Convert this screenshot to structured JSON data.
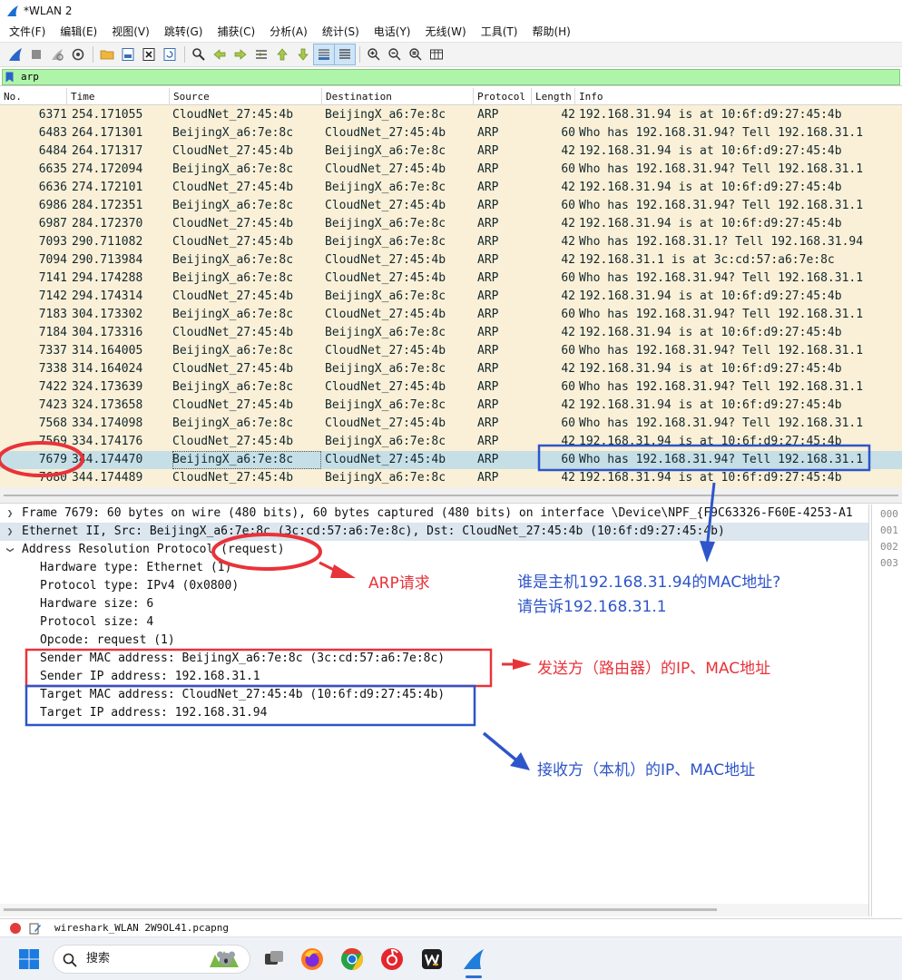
{
  "window": {
    "title": "*WLAN 2"
  },
  "menu": [
    "文件(F)",
    "编辑(E)",
    "视图(V)",
    "跳转(G)",
    "捕获(C)",
    "分析(A)",
    "统计(S)",
    "电话(Y)",
    "无线(W)",
    "工具(T)",
    "帮助(H)"
  ],
  "filter": {
    "value": "arp"
  },
  "columns": {
    "no": "No.",
    "time": "Time",
    "source": "Source",
    "destination": "Destination",
    "protocol": "Protocol",
    "length": "Length",
    "info": "Info"
  },
  "packets": [
    {
      "no": "6371",
      "time": "254.171055",
      "src": "CloudNet_27:45:4b",
      "dst": "BeijingX_a6:7e:8c",
      "proto": "ARP",
      "len": "42",
      "info": "192.168.31.94 is at 10:6f:d9:27:45:4b"
    },
    {
      "no": "6483",
      "time": "264.171301",
      "src": "BeijingX_a6:7e:8c",
      "dst": "CloudNet_27:45:4b",
      "proto": "ARP",
      "len": "60",
      "info": "Who has 192.168.31.94? Tell 192.168.31.1"
    },
    {
      "no": "6484",
      "time": "264.171317",
      "src": "CloudNet_27:45:4b",
      "dst": "BeijingX_a6:7e:8c",
      "proto": "ARP",
      "len": "42",
      "info": "192.168.31.94 is at 10:6f:d9:27:45:4b"
    },
    {
      "no": "6635",
      "time": "274.172094",
      "src": "BeijingX_a6:7e:8c",
      "dst": "CloudNet_27:45:4b",
      "proto": "ARP",
      "len": "60",
      "info": "Who has 192.168.31.94? Tell 192.168.31.1"
    },
    {
      "no": "6636",
      "time": "274.172101",
      "src": "CloudNet_27:45:4b",
      "dst": "BeijingX_a6:7e:8c",
      "proto": "ARP",
      "len": "42",
      "info": "192.168.31.94 is at 10:6f:d9:27:45:4b"
    },
    {
      "no": "6986",
      "time": "284.172351",
      "src": "BeijingX_a6:7e:8c",
      "dst": "CloudNet_27:45:4b",
      "proto": "ARP",
      "len": "60",
      "info": "Who has 192.168.31.94? Tell 192.168.31.1"
    },
    {
      "no": "6987",
      "time": "284.172370",
      "src": "CloudNet_27:45:4b",
      "dst": "BeijingX_a6:7e:8c",
      "proto": "ARP",
      "len": "42",
      "info": "192.168.31.94 is at 10:6f:d9:27:45:4b"
    },
    {
      "no": "7093",
      "time": "290.711082",
      "src": "CloudNet_27:45:4b",
      "dst": "BeijingX_a6:7e:8c",
      "proto": "ARP",
      "len": "42",
      "info": "Who has 192.168.31.1? Tell 192.168.31.94"
    },
    {
      "no": "7094",
      "time": "290.713984",
      "src": "BeijingX_a6:7e:8c",
      "dst": "CloudNet_27:45:4b",
      "proto": "ARP",
      "len": "42",
      "info": "192.168.31.1 is at 3c:cd:57:a6:7e:8c"
    },
    {
      "no": "7141",
      "time": "294.174288",
      "src": "BeijingX_a6:7e:8c",
      "dst": "CloudNet_27:45:4b",
      "proto": "ARP",
      "len": "60",
      "info": "Who has 192.168.31.94? Tell 192.168.31.1"
    },
    {
      "no": "7142",
      "time": "294.174314",
      "src": "CloudNet_27:45:4b",
      "dst": "BeijingX_a6:7e:8c",
      "proto": "ARP",
      "len": "42",
      "info": "192.168.31.94 is at 10:6f:d9:27:45:4b"
    },
    {
      "no": "7183",
      "time": "304.173302",
      "src": "BeijingX_a6:7e:8c",
      "dst": "CloudNet_27:45:4b",
      "proto": "ARP",
      "len": "60",
      "info": "Who has 192.168.31.94? Tell 192.168.31.1"
    },
    {
      "no": "7184",
      "time": "304.173316",
      "src": "CloudNet_27:45:4b",
      "dst": "BeijingX_a6:7e:8c",
      "proto": "ARP",
      "len": "42",
      "info": "192.168.31.94 is at 10:6f:d9:27:45:4b"
    },
    {
      "no": "7337",
      "time": "314.164005",
      "src": "BeijingX_a6:7e:8c",
      "dst": "CloudNet_27:45:4b",
      "proto": "ARP",
      "len": "60",
      "info": "Who has 192.168.31.94? Tell 192.168.31.1"
    },
    {
      "no": "7338",
      "time": "314.164024",
      "src": "CloudNet_27:45:4b",
      "dst": "BeijingX_a6:7e:8c",
      "proto": "ARP",
      "len": "42",
      "info": "192.168.31.94 is at 10:6f:d9:27:45:4b"
    },
    {
      "no": "7422",
      "time": "324.173639",
      "src": "BeijingX_a6:7e:8c",
      "dst": "CloudNet_27:45:4b",
      "proto": "ARP",
      "len": "60",
      "info": "Who has 192.168.31.94? Tell 192.168.31.1"
    },
    {
      "no": "7423",
      "time": "324.173658",
      "src": "CloudNet_27:45:4b",
      "dst": "BeijingX_a6:7e:8c",
      "proto": "ARP",
      "len": "42",
      "info": "192.168.31.94 is at 10:6f:d9:27:45:4b"
    },
    {
      "no": "7568",
      "time": "334.174098",
      "src": "BeijingX_a6:7e:8c",
      "dst": "CloudNet_27:45:4b",
      "proto": "ARP",
      "len": "60",
      "info": "Who has 192.168.31.94? Tell 192.168.31.1"
    },
    {
      "no": "7569",
      "time": "334.174176",
      "src": "CloudNet_27:45:4b",
      "dst": "BeijingX_a6:7e:8c",
      "proto": "ARP",
      "len": "42",
      "info": "192.168.31.94 is at 10:6f:d9:27:45:4b"
    },
    {
      "no": "7679",
      "time": "344.174470",
      "src": "BeijingX_a6:7e:8c",
      "dst": "CloudNet_27:45:4b",
      "proto": "ARP",
      "len": "60",
      "info": "Who has 192.168.31.94? Tell 192.168.31.1",
      "selected": true
    },
    {
      "no": "7680",
      "time": "344.174489",
      "src": "CloudNet_27:45:4b",
      "dst": "BeijingX_a6:7e:8c",
      "proto": "ARP",
      "len": "42",
      "info": "192.168.31.94 is at 10:6f:d9:27:45:4b"
    }
  ],
  "details": {
    "frame": "Frame 7679: 60 bytes on wire (480 bits), 60 bytes captured (480 bits) on interface \\Device\\NPF_{F9C63326-F60E-4253-A1",
    "ethernet": "Ethernet II, Src: BeijingX_a6:7e:8c (3c:cd:57:a6:7e:8c), Dst: CloudNet_27:45:4b (10:6f:d9:27:45:4b)",
    "arp": "Address Resolution Protocol (request)",
    "fields": [
      "Hardware type: Ethernet (1)",
      "Protocol type: IPv4 (0x0800)",
      "Hardware size: 6",
      "Protocol size: 4",
      "Opcode: request (1)",
      "Sender MAC address: BeijingX_a6:7e:8c (3c:cd:57:a6:7e:8c)",
      "Sender IP address: 192.168.31.1",
      "Target MAC address: CloudNet_27:45:4b (10:6f:d9:27:45:4b)",
      "Target IP address: 192.168.31.94"
    ]
  },
  "bytes": [
    "000",
    "001",
    "002",
    "003"
  ],
  "status": {
    "file": "wireshark_WLAN 2W9OL41.pcapng"
  },
  "taskbar": {
    "search_label": "搜索"
  },
  "annotations": {
    "arp_request": "ARP请求",
    "question_line1": "谁是主机192.168.31.94的MAC地址?",
    "question_line2": "请告诉192.168.31.1",
    "sender": "发送方（路由器）的IP、MAC地址",
    "receiver": "接收方（本机）的IP、MAC地址"
  },
  "colors": {
    "packet_bg": "#faf0d7",
    "selected_row": "#c6dfe6",
    "filter_bg": "#aff5a9",
    "annotation_red": "#e8333a",
    "annotation_blue": "#2e55c9"
  }
}
